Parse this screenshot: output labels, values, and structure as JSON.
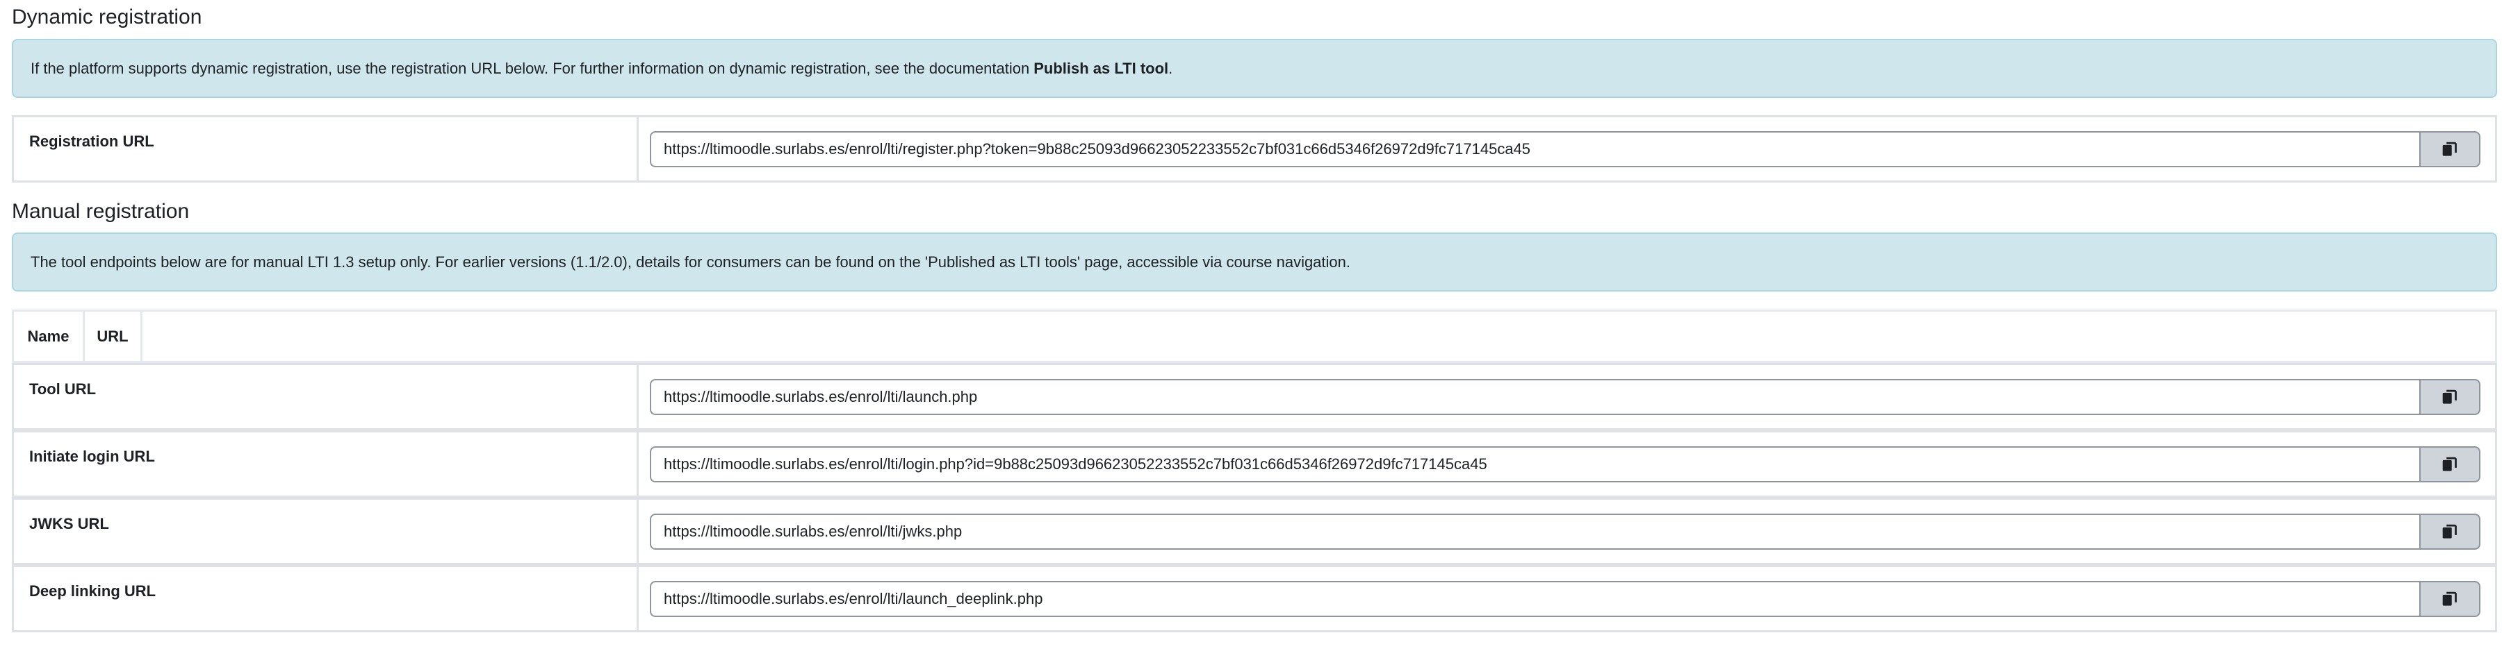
{
  "dynamic": {
    "heading": "Dynamic registration",
    "info_text": "If the platform supports dynamic registration, use the registration URL below. For further information on dynamic registration, see the documentation",
    "info_link": "Publish as LTI tool",
    "info_suffix": ".",
    "registration": {
      "label": "Registration URL",
      "value": "https://ltimoodle.surlabs.es/enrol/lti/register.php?token=9b88c25093d96623052233552c7bf031c66d5346f26972d9fc717145ca45"
    }
  },
  "manual": {
    "heading": "Manual registration",
    "info_text": "The tool endpoints below are for manual LTI 1.3 setup only. For earlier versions (1.1/2.0), details for consumers can be found on the 'Published as LTI tools' page, accessible via course navigation.",
    "table_headers": {
      "name": "Name",
      "url": "URL"
    },
    "rows": [
      {
        "label": "Tool URL",
        "value": "https://ltimoodle.surlabs.es/enrol/lti/launch.php"
      },
      {
        "label": "Initiate login URL",
        "value": "https://ltimoodle.surlabs.es/enrol/lti/login.php?id=9b88c25093d96623052233552c7bf031c66d5346f26972d9fc717145ca45"
      },
      {
        "label": "JWKS URL",
        "value": "https://ltimoodle.surlabs.es/enrol/lti/jwks.php"
      },
      {
        "label": "Deep linking URL",
        "value": "https://ltimoodle.surlabs.es/enrol/lti/launch_deeplink.php"
      }
    ]
  },
  "icons": {
    "copy": "copy-icon"
  },
  "colors": {
    "info_bg": "#cfe7ec",
    "info_border": "#a9d7df",
    "copy_btn_bg": "#ced4da",
    "text": "#1d2125"
  }
}
